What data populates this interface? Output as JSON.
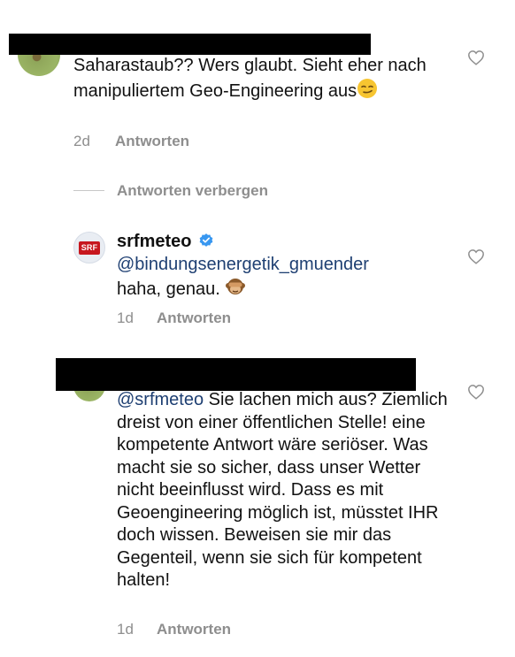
{
  "comment1": {
    "text": "Saharastaub?? Wers glaubt. Sieht eher nach manipuliertem Geo-Engineering aus",
    "emoji": "smirk-emoji",
    "time": "2d",
    "reply_label": "Antworten"
  },
  "hide_replies_label": "Antworten verbergen",
  "reply": {
    "username": "srfmeteo",
    "verified": true,
    "avatar_text": "SRF",
    "mention": "@bindungsenergetik_gmuender",
    "text": "haha, genau.",
    "emoji": "see-no-evil-monkey-emoji",
    "time": "1d",
    "reply_label": "Antworten"
  },
  "comment2": {
    "mention": "@srfmeteo",
    "text": "Sie lachen mich aus? Ziemlich dreist von einer öffentlichen Stelle! eine kompetente Antwort wäre seriöser. Was macht sie so sicher, dass unser Wetter nicht beeinflusst wird. Dass es mit Geoengineering möglich ist, müsstet IHR doch wissen. Beweisen sie mir das Gegenteil, wenn sie sich für kompetent halten!",
    "time": "1d",
    "reply_label": "Antworten"
  },
  "colors": {
    "mention": "#1e3f72",
    "meta": "#8e8e8e",
    "verified": "#3897f0",
    "srf_red": "#c7171e"
  }
}
